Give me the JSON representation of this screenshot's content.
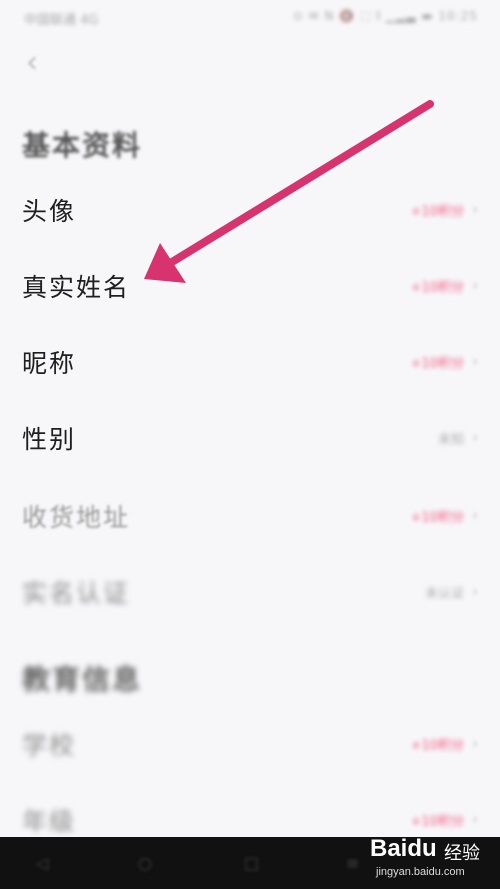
{
  "status_bar": {
    "left": "中国联通 4G",
    "right": "⊙ ✉ N 🔇 ⬚ 𝄃 ▁▂▃ ▬ 10:25"
  },
  "header": {
    "back_icon": "chevron-left-icon",
    "back_glyph": "‹"
  },
  "sections": [
    {
      "title": "基本资料",
      "rows": [
        {
          "label": "头像",
          "value": "+10积分",
          "value_color": "#f3557c"
        },
        {
          "label": "真实姓名",
          "value": "+10积分",
          "value_color": "#f3557c"
        },
        {
          "label": "昵称",
          "value": "+10积分",
          "value_color": "#f3557c"
        },
        {
          "label": "性别",
          "value": "未知",
          "value_color": "#aaaaaa"
        },
        {
          "label": "收货地址",
          "value": "+10积分",
          "value_color": "#f3557c"
        },
        {
          "label": "实名认证",
          "value": "未认证",
          "value_color": "#aaaaaa"
        }
      ]
    },
    {
      "title": "教育信息",
      "rows": [
        {
          "label": "学校",
          "value": "+10积分",
          "value_color": "#f3557c"
        },
        {
          "label": "年级",
          "value": "+10积分",
          "value_color": "#f3557c"
        }
      ]
    }
  ],
  "chevron_glyph": "›",
  "annotation": {
    "arrow_color": "#d6336f"
  },
  "nav_bar": {
    "back": "◁",
    "home": "○",
    "recent": "□",
    "menu": "≡"
  },
  "watermark": {
    "brand_a": "Bai",
    "brand_b": "du",
    "brand_cn": "经验",
    "url": "jingyan.baidu.com"
  }
}
